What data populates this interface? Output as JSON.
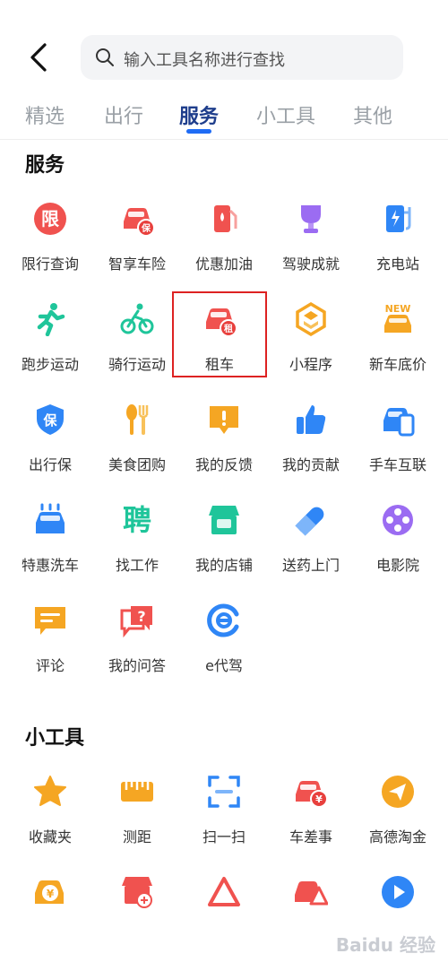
{
  "search": {
    "placeholder": "输入工具名称进行查找"
  },
  "tabs": [
    {
      "label": "精选"
    },
    {
      "label": "出行"
    },
    {
      "label": "服务"
    },
    {
      "label": "小工具"
    },
    {
      "label": "其他"
    }
  ],
  "active_tab": "服务",
  "sections": {
    "service": {
      "title": "服务",
      "items": [
        {
          "label": "限行查询",
          "icon": "restriction-icon"
        },
        {
          "label": "智享车险",
          "icon": "car-insurance-icon"
        },
        {
          "label": "优惠加油",
          "icon": "fuel-icon"
        },
        {
          "label": "驾驶成就",
          "icon": "trophy-icon"
        },
        {
          "label": "充电站",
          "icon": "charging-station-icon"
        },
        {
          "label": "跑步运动",
          "icon": "running-icon"
        },
        {
          "label": "骑行运动",
          "icon": "cycling-icon"
        },
        {
          "label": "租车",
          "icon": "car-rental-icon"
        },
        {
          "label": "小程序",
          "icon": "mini-program-icon"
        },
        {
          "label": "新车底价",
          "icon": "new-car-icon"
        },
        {
          "label": "出行保",
          "icon": "travel-insurance-icon"
        },
        {
          "label": "美食团购",
          "icon": "food-icon"
        },
        {
          "label": "我的反馈",
          "icon": "feedback-icon"
        },
        {
          "label": "我的贡献",
          "icon": "thumbs-up-icon"
        },
        {
          "label": "手车互联",
          "icon": "phone-car-icon"
        },
        {
          "label": "特惠洗车",
          "icon": "car-wash-icon"
        },
        {
          "label": "找工作",
          "icon": "job-icon"
        },
        {
          "label": "我的店铺",
          "icon": "shop-icon"
        },
        {
          "label": "送药上门",
          "icon": "medicine-icon"
        },
        {
          "label": "电影院",
          "icon": "film-reel-icon"
        },
        {
          "label": "评论",
          "icon": "comment-icon"
        },
        {
          "label": "我的问答",
          "icon": "qa-icon"
        },
        {
          "label": "e代驾",
          "icon": "e-driver-icon"
        }
      ]
    },
    "tools": {
      "title": "小工具",
      "items": [
        {
          "label": "收藏夹",
          "icon": "star-icon"
        },
        {
          "label": "测距",
          "icon": "ruler-icon"
        },
        {
          "label": "扫一扫",
          "icon": "scan-icon"
        },
        {
          "label": "车差事",
          "icon": "car-errand-icon"
        },
        {
          "label": "高德淘金",
          "icon": "send-icon"
        },
        {
          "label": "",
          "icon": "car-yen-icon"
        },
        {
          "label": "",
          "icon": "shop-add-icon"
        },
        {
          "label": "",
          "icon": "warning-triangle-icon"
        },
        {
          "label": "",
          "icon": "car-warning-icon"
        },
        {
          "label": "",
          "icon": "play-icon"
        }
      ]
    }
  },
  "highlighted_item": "租车",
  "watermark": "Baidu 经验",
  "colors": {
    "accent": "#1f6cf5",
    "active_tab": "#1f3e8c",
    "highlight_box": "#dd2222"
  }
}
